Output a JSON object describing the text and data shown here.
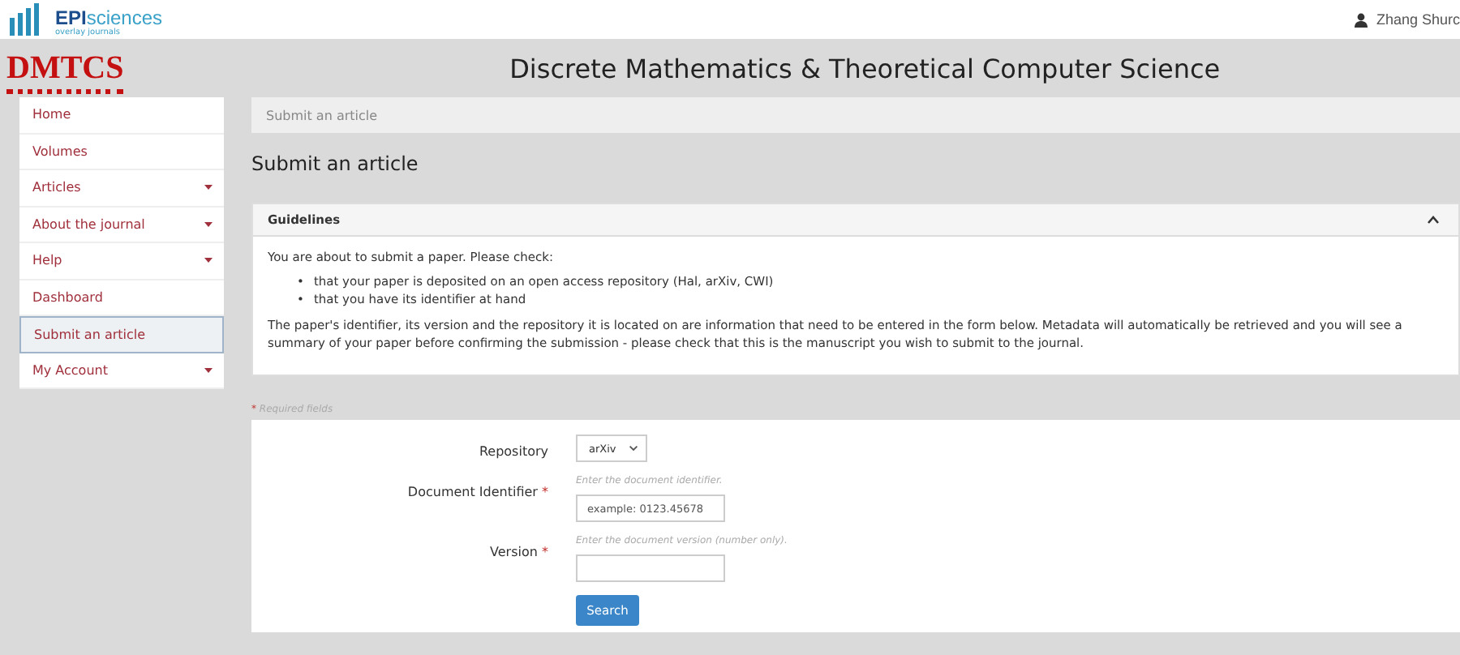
{
  "topbar": {
    "logo_text": "EPI",
    "logo_text_2": "sciences",
    "logo_tagline": "overlay journals",
    "user": "Zhang Shurc"
  },
  "journal": {
    "logo": "DMTCS",
    "title": "Discrete Mathematics & Theoretical Computer Science"
  },
  "sidebar": {
    "items": [
      {
        "label": "Home",
        "expandable": false,
        "selected": false
      },
      {
        "label": "Volumes",
        "expandable": false,
        "selected": false
      },
      {
        "label": "Articles",
        "expandable": true,
        "selected": false
      },
      {
        "label": "About the journal",
        "expandable": true,
        "selected": false
      },
      {
        "label": "Help",
        "expandable": true,
        "selected": false
      },
      {
        "label": "Dashboard",
        "expandable": false,
        "selected": false
      },
      {
        "label": "Submit an article",
        "expandable": false,
        "selected": true
      },
      {
        "label": "My Account",
        "expandable": true,
        "selected": false
      }
    ]
  },
  "breadcrumb": "Submit an article",
  "page_title": "Submit an article",
  "guidelines": {
    "title": "Guidelines",
    "bullet": "•",
    "intro": "You are about to submit a paper. Please check:",
    "bullets": [
      "that your paper is deposited on an open access repository (Hal, arXiv, CWI)",
      "that you have its identifier at hand"
    ],
    "body": "The paper's identifier, its version and the repository it is located on are information that need to be entered in the form below. Metadata will automatically be retrieved and you will see a summary of your paper before confirming the submission - please check that this is the manuscript you wish to submit to the journal."
  },
  "form": {
    "required_mark": "*",
    "required_note": "Required fields",
    "fields": [
      {
        "kind": "select",
        "label": "Repository",
        "required": false,
        "value": "arXiv"
      },
      {
        "kind": "text",
        "label": "Document Identifier",
        "required": true,
        "help": "Enter the document identifier.",
        "placeholder": "example: 0123.45678"
      },
      {
        "kind": "text",
        "label": "Version",
        "required": true,
        "help": "Enter the document version (number only)."
      }
    ],
    "button": "Search"
  }
}
